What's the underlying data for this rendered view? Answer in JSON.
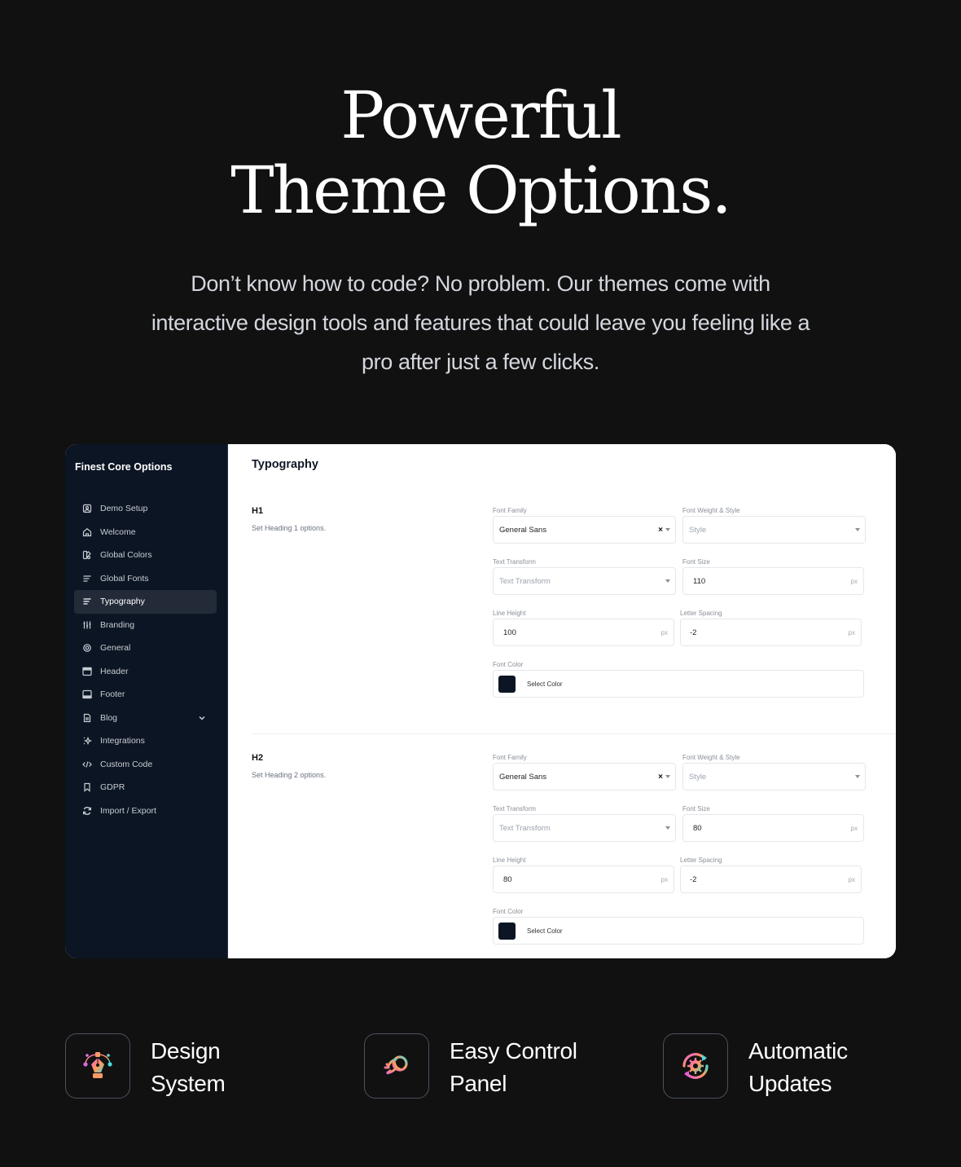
{
  "hero": {
    "title_line1": "Powerful",
    "title_line2": "Theme Options.",
    "subtitle": "Don’t know how to code? No problem. Our themes come with interactive design tools and features that could leave you feeling like a pro after just a few clicks."
  },
  "sidebar": {
    "title": "Finest Core Options",
    "items": [
      {
        "label": "Demo Setup",
        "icon": "demo-setup-icon"
      },
      {
        "label": "Welcome",
        "icon": "home-icon"
      },
      {
        "label": "Global Colors",
        "icon": "palette-icon"
      },
      {
        "label": "Global Fonts",
        "icon": "text-lines-icon"
      },
      {
        "label": "Typography",
        "icon": "text-lines-icon",
        "active": true
      },
      {
        "label": "Branding",
        "icon": "sliders-icon"
      },
      {
        "label": "General",
        "icon": "gear-icon"
      },
      {
        "label": "Header",
        "icon": "header-layout-icon"
      },
      {
        "label": "Footer",
        "icon": "footer-layout-icon"
      },
      {
        "label": "Blog",
        "icon": "document-icon",
        "expandable": true
      },
      {
        "label": "Integrations",
        "icon": "sparkle-icon"
      },
      {
        "label": "Custom Code",
        "icon": "code-icon"
      },
      {
        "label": "GDPR",
        "icon": "bookmark-icon"
      },
      {
        "label": "Import / Export",
        "icon": "sync-icon"
      }
    ]
  },
  "main": {
    "title": "Typography",
    "sections": [
      {
        "heading": "H1",
        "description": "Set Heading 1 options.",
        "font_family_label": "Font Family",
        "font_family_value": "General Sans",
        "font_weight_label": "Font Weight & Style",
        "font_weight_placeholder": "Style",
        "text_transform_label": "Text Transform",
        "text_transform_placeholder": "Text Transform",
        "font_size_label": "Font Size",
        "font_size_value": "110",
        "line_height_label": "Line Height",
        "line_height_value": "100",
        "letter_spacing_label": "Letter Spacing",
        "letter_spacing_value": "-2",
        "unit": "px",
        "font_color_label": "Font Color",
        "font_color_button": "Select Color",
        "font_color_value": "#0c1523"
      },
      {
        "heading": "H2",
        "description": "Set Heading 2 options.",
        "font_family_label": "Font Family",
        "font_family_value": "General Sans",
        "font_weight_label": "Font Weight & Style",
        "font_weight_placeholder": "Style",
        "text_transform_label": "Text Transform",
        "text_transform_placeholder": "Text Transform",
        "font_size_label": "Font Size",
        "font_size_value": "80",
        "line_height_label": "Line Height",
        "line_height_value": "80",
        "letter_spacing_label": "Letter Spacing",
        "letter_spacing_value": "-2",
        "unit": "px",
        "font_color_label": "Font Color",
        "font_color_button": "Select Color",
        "font_color_value": "#0c1523"
      }
    ]
  },
  "features": [
    {
      "line1": "Design",
      "line2": "System",
      "icon": "pen-tool-icon"
    },
    {
      "line1": "Easy Control",
      "line2": "Panel",
      "icon": "rocket-ball-icon"
    },
    {
      "line1": "Automatic",
      "line2": "Updates",
      "icon": "gear-sync-icon"
    }
  ],
  "colors": {
    "page_bg": "#111111",
    "sidebar_bg": "#0c1523",
    "active_item_bg": "#232b38",
    "gradient_pink": "#e85cd8",
    "gradient_orange": "#ff9a5a",
    "gradient_cyan": "#4fd8d8"
  }
}
